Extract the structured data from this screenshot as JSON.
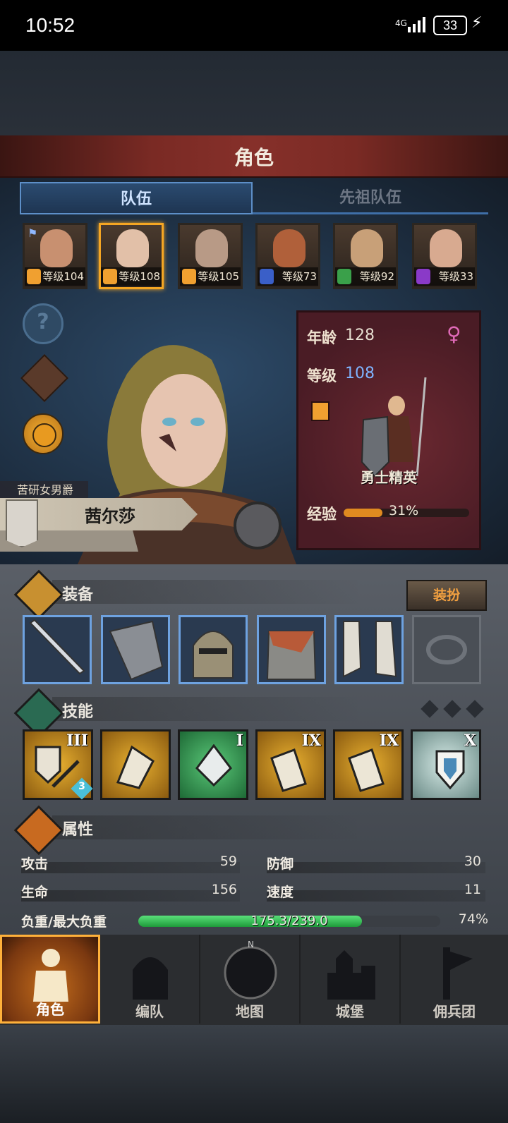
{
  "status_bar": {
    "time": "10:52",
    "network": "4G",
    "battery": "33"
  },
  "header": {
    "title": "角色"
  },
  "tabs": [
    {
      "label": "队伍",
      "active": true
    },
    {
      "label": "先祖队伍",
      "active": false
    }
  ],
  "heroes": [
    {
      "level_text": "等级104",
      "class_color": "#f0a030",
      "selected": false
    },
    {
      "level_text": "等级108",
      "class_color": "#f0a030",
      "selected": true
    },
    {
      "level_text": "等级105",
      "class_color": "#f0a030",
      "selected": false
    },
    {
      "level_text": "等级73",
      "class_color": "#3a5fc8",
      "selected": false
    },
    {
      "level_text": "等级92",
      "class_color": "#3aa04a",
      "selected": false
    },
    {
      "level_text": "等级33",
      "class_color": "#8a3ac8",
      "selected": false
    }
  ],
  "character": {
    "title": "苦研女男爵",
    "name": "茜尔莎",
    "age_label": "年龄",
    "age": "128",
    "level_label": "等级",
    "level": "108",
    "class_name": "勇士精英",
    "exp_label": "经验",
    "exp_percent": "31%",
    "exp_fraction": 0.31
  },
  "equipment": {
    "title": "装备",
    "dress_button": "装扮",
    "slots": [
      "sword",
      "shield",
      "helmet",
      "armor",
      "boots",
      "ring"
    ]
  },
  "skills": {
    "title": "技能",
    "items": [
      {
        "rank": "III",
        "badge": "3",
        "color": "#c8901c"
      },
      {
        "rank": "",
        "badge": "",
        "color": "#c8901c"
      },
      {
        "rank": "I",
        "badge": "",
        "color": "#3da55a"
      },
      {
        "rank": "IX",
        "badge": "",
        "color": "#c8901c"
      },
      {
        "rank": "IX",
        "badge": "",
        "color": "#c8901c"
      },
      {
        "rank": "X",
        "badge": "",
        "color": "#a8c4c0"
      }
    ]
  },
  "attributes": {
    "title": "属性",
    "attack_label": "攻击",
    "attack": "59",
    "defense_label": "防御",
    "defense": "30",
    "health_label": "生命",
    "health": "156",
    "speed_label": "速度",
    "speed": "11",
    "load_label": "负重/最大负重",
    "load": "175.3/239.0",
    "load_percent": "74%",
    "load_fraction": 0.74
  },
  "nav": [
    {
      "label": "角色",
      "active": true
    },
    {
      "label": "编队",
      "active": false
    },
    {
      "label": "地图",
      "active": false
    },
    {
      "label": "城堡",
      "active": false
    },
    {
      "label": "佣兵团",
      "active": false
    }
  ]
}
